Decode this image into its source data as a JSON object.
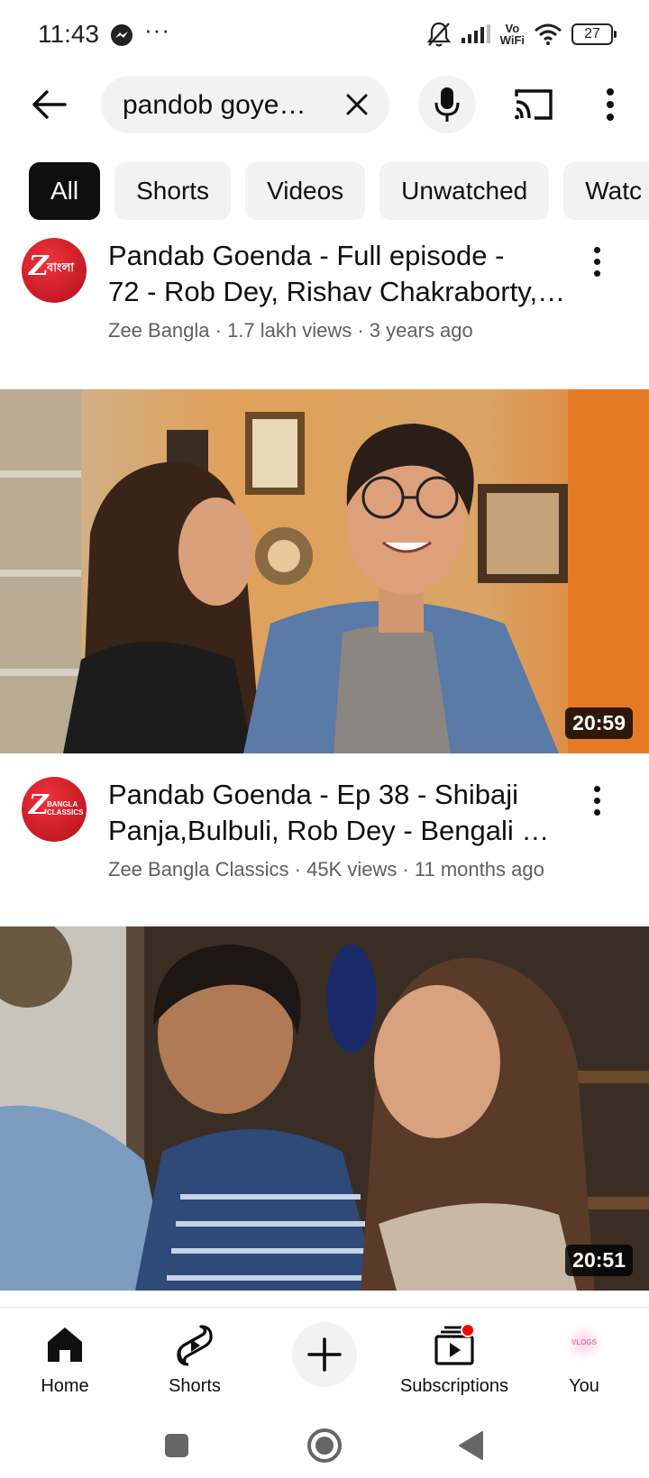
{
  "status_bar": {
    "time": "11:43",
    "dots": "···",
    "vo_top": "Vo",
    "vo_bottom": "WiFi",
    "battery": "27"
  },
  "search": {
    "query": "pandob goye…"
  },
  "chips": [
    "All",
    "Shorts",
    "Videos",
    "Unwatched",
    "Watc"
  ],
  "results": [
    {
      "channel_avatar_text": "বাংলা",
      "title_line1": "Pandab Goenda - Full episode -",
      "title_line2": "72 - Rob Dey, Rishav Chakraborty,…",
      "meta": "Zee Bangla · 1.7 lakh views · 3 years ago",
      "duration": "20:59"
    },
    {
      "channel_avatar_text": "BANGLA CLASSICS",
      "title_line1": "Pandab Goenda - Ep 38 - Shibaji",
      "title_line2": "Panja,Bulbuli, Rob Dey - Bengali …",
      "meta": "Zee Bangla Classics · 45K views · 11 months ago",
      "duration": "20:51"
    }
  ],
  "bottom_nav": {
    "home": "Home",
    "shorts": "Shorts",
    "subscriptions": "Subscriptions",
    "you": "You",
    "you_avatar_text": "VLOGS"
  },
  "colors": {
    "accent_red": "#ff0000",
    "chip_bg": "#f2f2f2",
    "text_primary": "#0f0f0f",
    "text_secondary": "#606060"
  }
}
